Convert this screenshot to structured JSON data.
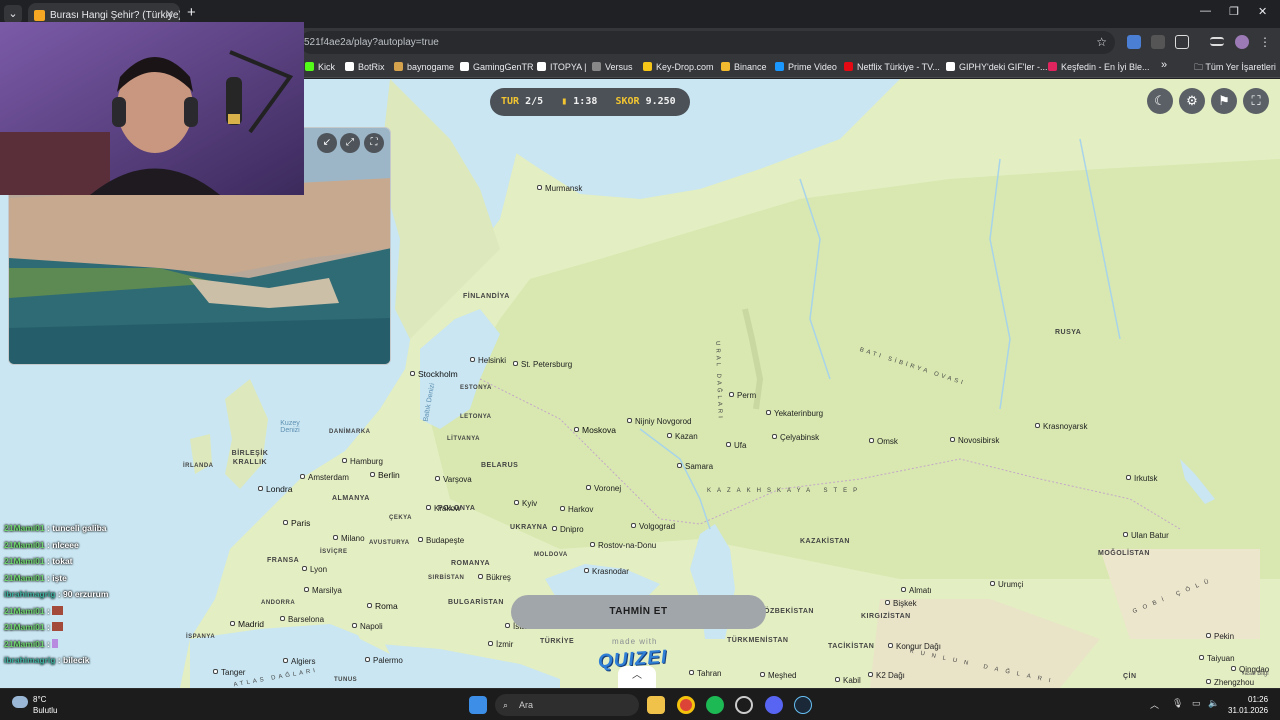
{
  "browser": {
    "tab_title": "Burası Hangi Şehir? (Türkiye) - Ç",
    "url": "521f4ae2a/play?autoplay=true",
    "bookmarks": [
      "Kick",
      "BotRix",
      "baynogame",
      "GamingGenTR",
      "ITOPYA |",
      "Versus",
      "Key-Drop.com",
      "Binance",
      "Prime Video",
      "Netflix Türkiye - TV...",
      "GIPHY'deki GIF'ler -...",
      "Keşfedin - En İyi Ble..."
    ],
    "bookmark_colors": [
      "#53fc18",
      "#ffffff",
      "#d4a24c",
      "#ffffff",
      "#ffffff",
      "#888888",
      "#f5c518",
      "#f3ba2f",
      "#1a98ff",
      "#e50914",
      "#ffffff",
      "#e0245e"
    ],
    "all_bookmarks": "Tüm Yer İşaretleri",
    "more_bookmarks": "»"
  },
  "game": {
    "round_label": "TUR",
    "round_value": "2/5",
    "timer": "1:38",
    "score_label": "SKOR",
    "score_value": "9.250",
    "guess_button": "TAHMİN ET",
    "made_with": "made with",
    "brand": "QUIZEI",
    "attribution": "Yasal Bilgi"
  },
  "map_labels": {
    "countries": [
      "FİNLANDİYA",
      "RUSYA",
      "ESTONYA",
      "LETONYA",
      "LİTVANYA",
      "BELARUS",
      "UKRAYNA",
      "POLONYA",
      "ALMANYA",
      "FRANSA",
      "İSVİÇRE",
      "AVUSTURYA",
      "ROMANYA",
      "MOLDOVA",
      "BULGARİSTAN",
      "TÜRKİYE",
      "KAZAKİSTAN",
      "MOĞOLİSTAN",
      "ÖZBEKİSTAN",
      "KIRGIZİSTAN",
      "TÜRKMENİSTAN",
      "TACİKİSTAN",
      "BİRLEŞİK KRALLIK",
      "İRLANDA",
      "DANİMARKA",
      "ÇEKYA",
      "SIRBİSTAN",
      "ANDORRA",
      "TUNUS",
      "ÇİN",
      "İSPANYA"
    ],
    "cities": [
      "Murmansk",
      "Helsinki",
      "St. Petersburg",
      "Stockholm",
      "Moskova",
      "Nijniy Novgorod",
      "Kazan",
      "Perm",
      "Yekaterinburg",
      "Ufa",
      "Çelyabinsk",
      "Omsk",
      "Novosibirsk",
      "Krasnoyarsk",
      "Irkutsk",
      "Samara",
      "Voronej",
      "Volgograd",
      "Rostov-na-Donu",
      "Krasnodar",
      "Harkov",
      "Kyiv",
      "Dnipro",
      "Varşova",
      "Krakow",
      "Berlin",
      "Hamburg",
      "Amsterdam",
      "Londra",
      "Paris",
      "Milano",
      "Lyon",
      "Marsilya",
      "Roma",
      "Napoli",
      "Barselona",
      "Madrid",
      "Budapeşte",
      "Bükreş",
      "İstanbul",
      "İzmir",
      "Tahran",
      "Meşhed",
      "Bişkek",
      "Almatı",
      "Urumçi",
      "Ulan Batur",
      "Pekin",
      "Taiyuan",
      "Qingdao",
      "Zhengzhou",
      "Algiers",
      "Tanger",
      "Palermo",
      "Kabil",
      "Kongur Dağı",
      "K2 Dağı"
    ],
    "regions": [
      "URAL DAĞLARI",
      "BATI SİBİRYA OVASI",
      "KAZAKHSKAYA STEP",
      "GOBİ ÇÖLÜ",
      "KUNLUN DAĞLARI",
      "ATLAS DAĞLARI"
    ],
    "seas": [
      "Kuzey Denizi",
      "Baltık Denizi"
    ]
  },
  "chat": [
    {
      "user": "21Mami01",
      "text": ": tunceli galiba"
    },
    {
      "user": "21Mami01",
      "text": ": nlceee"
    },
    {
      "user": "21Mami01",
      "text": ": tokat"
    },
    {
      "user": "21Mami01",
      "text": ": işte"
    },
    {
      "user": "ibrahimagrig",
      "text": ": 90 erzurum"
    },
    {
      "user": "21Mami01",
      "text": ":"
    },
    {
      "user": "21Mami01",
      "text": ":"
    },
    {
      "user": "21Mami01",
      "text": ":"
    },
    {
      "user": "ibrahimagrig",
      "text": ": bilecik"
    }
  ],
  "taskbar": {
    "temp": "8°C",
    "weather": "Bulutlu",
    "search_placeholder": "Ara",
    "time": "01:26",
    "date": "31.01.2026"
  }
}
